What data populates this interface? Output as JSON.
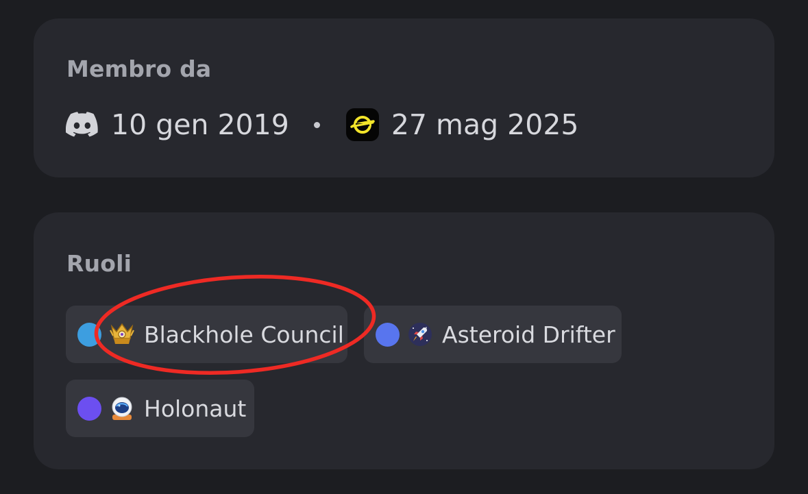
{
  "member_since": {
    "title": "Membro da",
    "discord_date": "10 gen 2019",
    "server_date": "27 mag 2025",
    "icons": [
      "discord-logo-icon",
      "server-logo-icon"
    ]
  },
  "roles": {
    "title": "Ruoli",
    "items": [
      {
        "label": "Blackhole Council",
        "color": "#3d9ee0",
        "emoji": "crown-emblem-icon"
      },
      {
        "label": "Asteroid Drifter",
        "color": "#5875ee",
        "emoji": "rocket-icon"
      },
      {
        "label": "Holonaut",
        "color": "#6c4ff0",
        "emoji": "astronaut-helmet-icon"
      }
    ]
  },
  "annotation": {
    "color": "#ee2a24",
    "target": "Blackhole Council"
  }
}
